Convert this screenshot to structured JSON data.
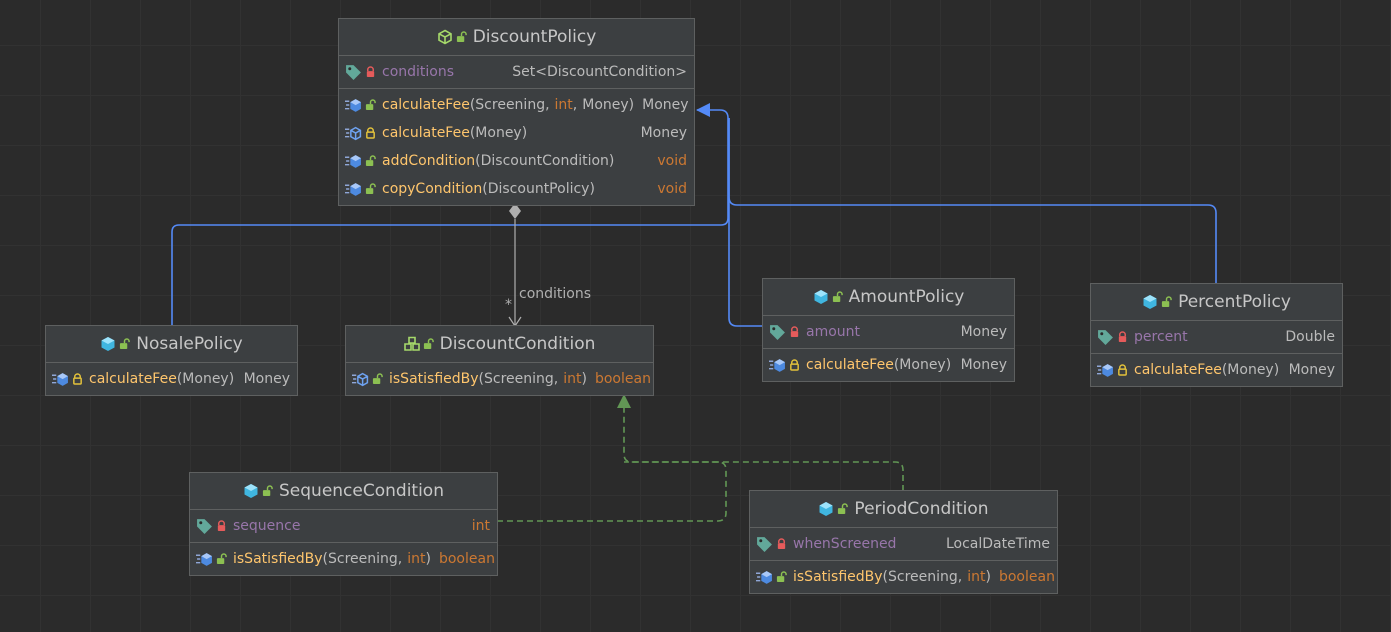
{
  "classes": {
    "discount_policy": {
      "name": "DiscountPolicy",
      "icon": "abstract-class-icon",
      "fields": [
        {
          "name": "conditions",
          "type": "Set<DiscountCondition>",
          "visibility": "private"
        }
      ],
      "methods": [
        {
          "name": "calculateFee",
          "params": [
            "Screening",
            "int",
            "Money"
          ],
          "return": "Money",
          "visibility": "public"
        },
        {
          "name": "calculateFee",
          "params": [
            "Money"
          ],
          "return": "Money",
          "visibility": "protected",
          "abstract": true
        },
        {
          "name": "addCondition",
          "params": [
            "DiscountCondition"
          ],
          "return": "void",
          "visibility": "public"
        },
        {
          "name": "copyCondition",
          "params": [
            "DiscountPolicy"
          ],
          "return": "void",
          "visibility": "public"
        }
      ]
    },
    "nosale_policy": {
      "name": "NosalePolicy",
      "icon": "class-icon",
      "methods": [
        {
          "name": "calculateFee",
          "params": [
            "Money"
          ],
          "return": "Money",
          "visibility": "protected"
        }
      ]
    },
    "discount_condition": {
      "name": "DiscountCondition",
      "icon": "interface-icon",
      "methods": [
        {
          "name": "isSatisfiedBy",
          "params": [
            "Screening",
            "int"
          ],
          "return": "boolean",
          "visibility": "public",
          "abstract": true
        }
      ]
    },
    "amount_policy": {
      "name": "AmountPolicy",
      "icon": "class-icon",
      "fields": [
        {
          "name": "amount",
          "type": "Money",
          "visibility": "private"
        }
      ],
      "methods": [
        {
          "name": "calculateFee",
          "params": [
            "Money"
          ],
          "return": "Money",
          "visibility": "protected"
        }
      ]
    },
    "percent_policy": {
      "name": "PercentPolicy",
      "icon": "class-icon",
      "fields": [
        {
          "name": "percent",
          "type": "Double",
          "visibility": "private"
        }
      ],
      "methods": [
        {
          "name": "calculateFee",
          "params": [
            "Money"
          ],
          "return": "Money",
          "visibility": "protected"
        }
      ]
    },
    "sequence_condition": {
      "name": "SequenceCondition",
      "icon": "class-icon",
      "fields": [
        {
          "name": "sequence",
          "type": "int",
          "visibility": "private"
        }
      ],
      "methods": [
        {
          "name": "isSatisfiedBy",
          "params": [
            "Screening",
            "int"
          ],
          "return": "boolean",
          "visibility": "public"
        }
      ]
    },
    "period_condition": {
      "name": "PeriodCondition",
      "icon": "class-icon",
      "fields": [
        {
          "name": "whenScreened",
          "type": "LocalDateTime",
          "visibility": "private"
        }
      ],
      "methods": [
        {
          "name": "isSatisfiedBy",
          "params": [
            "Screening",
            "int"
          ],
          "return": "boolean",
          "visibility": "public"
        }
      ]
    }
  },
  "relations": [
    {
      "type": "inheritance",
      "from": "NosalePolicy",
      "to": "DiscountPolicy"
    },
    {
      "type": "inheritance",
      "from": "AmountPolicy",
      "to": "DiscountPolicy"
    },
    {
      "type": "inheritance",
      "from": "PercentPolicy",
      "to": "DiscountPolicy"
    },
    {
      "type": "aggregation",
      "from": "DiscountPolicy",
      "to": "DiscountCondition",
      "label": "conditions",
      "multiplicity": "*"
    },
    {
      "type": "realization",
      "from": "SequenceCondition",
      "to": "DiscountCondition"
    },
    {
      "type": "realization",
      "from": "PeriodCondition",
      "to": "DiscountCondition"
    }
  ],
  "labels": {
    "aggregation_role": "conditions",
    "aggregation_multiplicity": "*",
    "comma": ","
  },
  "colors": {
    "background": "#2b2b2b",
    "node_bg": "#3c3f41",
    "inheritance": "#548af7",
    "realization": "#629755",
    "aggregation": "#afafaf",
    "method_name": "#ffc66d",
    "field_name": "#9876aa",
    "keyword": "#cc7832"
  }
}
